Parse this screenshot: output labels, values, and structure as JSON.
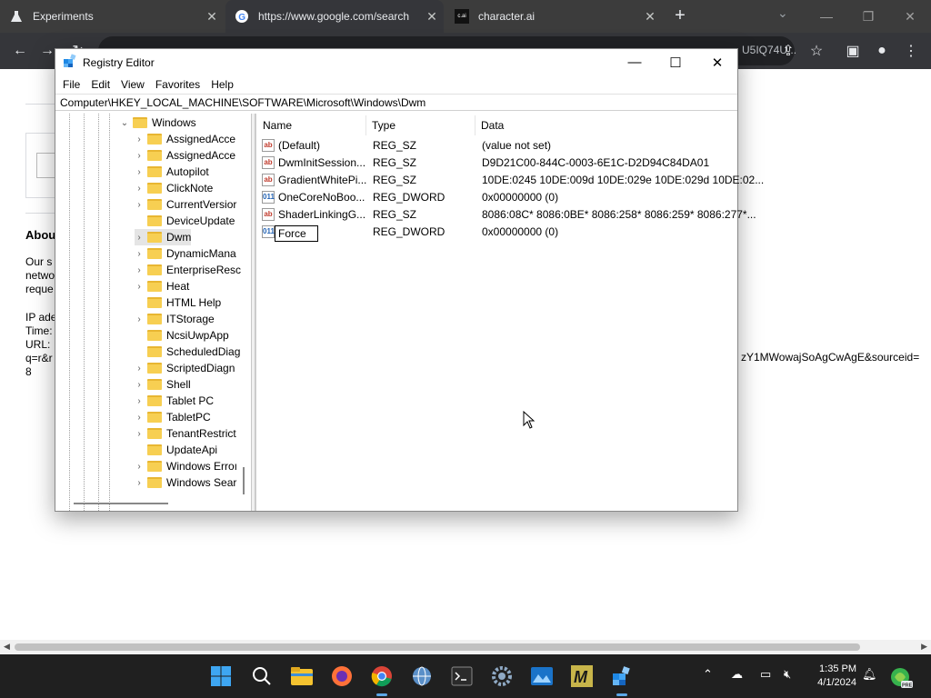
{
  "browser": {
    "tabs": [
      {
        "title": "Experiments"
      },
      {
        "title": "https://www.google.com/search"
      },
      {
        "title": "character.ai",
        "favicon_text": "c.ai"
      }
    ],
    "url_partial": "U5IQ74U..."
  },
  "webpage": {
    "heading": "Abou",
    "lines1": [
      "Our s",
      "netwo",
      "reque"
    ],
    "lines2": [
      "IP ade",
      "Time:",
      "URL:",
      "q=r&r",
      "8"
    ],
    "url_tail": "zY1MWowajSoAgCwAgE&sourceid="
  },
  "regedit": {
    "title": "Registry Editor",
    "menu": [
      "File",
      "Edit",
      "View",
      "Favorites",
      "Help"
    ],
    "address": "Computer\\HKEY_LOCAL_MACHINE\\SOFTWARE\\Microsoft\\Windows\\Dwm",
    "tree_parent": "Windows",
    "tree": [
      {
        "label": "AssignedAcce",
        "expandable": true
      },
      {
        "label": "AssignedAcce",
        "expandable": true
      },
      {
        "label": "Autopilot",
        "expandable": true
      },
      {
        "label": "ClickNote",
        "expandable": true
      },
      {
        "label": "CurrentVersior",
        "expandable": true
      },
      {
        "label": "DeviceUpdate",
        "expandable": false
      },
      {
        "label": "Dwm",
        "expandable": true,
        "selected": true
      },
      {
        "label": "DynamicMana",
        "expandable": true
      },
      {
        "label": "EnterpriseResc",
        "expandable": true
      },
      {
        "label": "Heat",
        "expandable": true
      },
      {
        "label": "HTML Help",
        "expandable": false
      },
      {
        "label": "ITStorage",
        "expandable": true
      },
      {
        "label": "NcsiUwpApp",
        "expandable": false
      },
      {
        "label": "ScheduledDiag",
        "expandable": false
      },
      {
        "label": "ScriptedDiagn",
        "expandable": true
      },
      {
        "label": "Shell",
        "expandable": true
      },
      {
        "label": "Tablet PC",
        "expandable": true
      },
      {
        "label": "TabletPC",
        "expandable": true
      },
      {
        "label": "TenantRestrict",
        "expandable": true
      },
      {
        "label": "UpdateApi",
        "expandable": false
      },
      {
        "label": "Windows Erroı",
        "expandable": true
      },
      {
        "label": "Windows Sear",
        "expandable": true
      }
    ],
    "columns": {
      "name": "Name",
      "type": "Type",
      "data": "Data"
    },
    "values": [
      {
        "icon": "string",
        "name": "(Default)",
        "type": "REG_SZ",
        "data": "(value not set)"
      },
      {
        "icon": "string",
        "name": "DwmInitSession...",
        "type": "REG_SZ",
        "data": "D9D21C00-844C-0003-6E1C-D2D94C84DA01"
      },
      {
        "icon": "string",
        "name": "GradientWhitePi...",
        "type": "REG_SZ",
        "data": "10DE:0245 10DE:009d 10DE:029e 10DE:029d 10DE:02..."
      },
      {
        "icon": "binary",
        "name": "OneCoreNoBoo...",
        "type": "REG_DWORD",
        "data": "0x00000000 (0)"
      },
      {
        "icon": "string",
        "name": "ShaderLinkingG...",
        "type": "REG_SZ",
        "data": "8086:08C* 8086:0BE* 8086:258* 8086:259* 8086:277*..."
      },
      {
        "icon": "binary",
        "name": "Force",
        "type": "REG_DWORD",
        "data": "0x00000000 (0)",
        "editing": true
      }
    ]
  },
  "taskbar": {
    "time": "1:35 PM",
    "date": "4/1/2024",
    "badge": "PRE"
  }
}
